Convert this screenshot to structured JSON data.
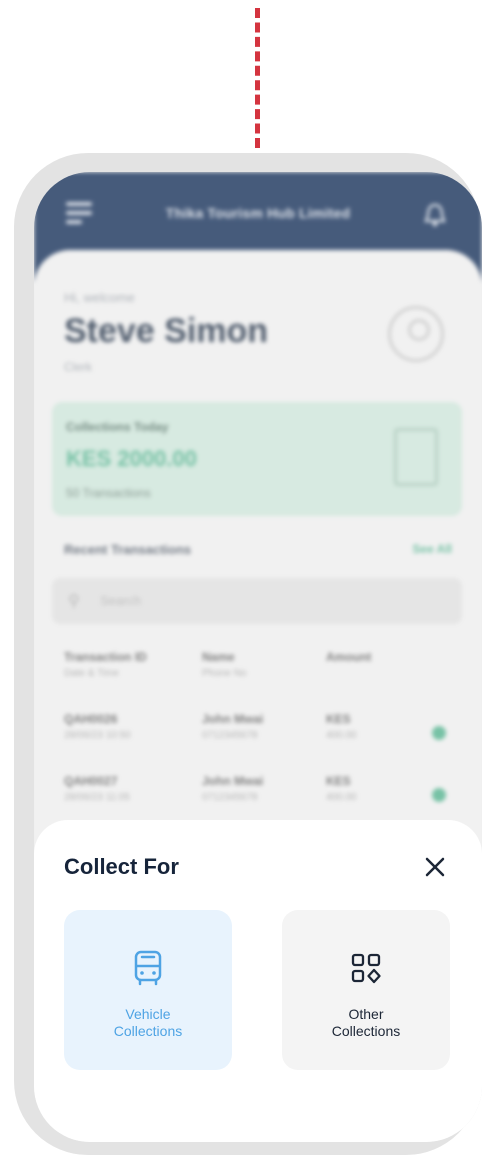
{
  "app": {
    "title": "Thika Tourism Hub Limited"
  },
  "dashboard": {
    "welcome": "Hi, welcome",
    "user_name": "Steve Simon",
    "user_role": "Clerk",
    "collections_label": "Collections Today",
    "collections_amount": "KES 2000.00",
    "collections_count": "50 Transactions",
    "recent_title": "Recent Transactions",
    "see_all": "See All",
    "search_placeholder": "Search",
    "table_headers": [
      {
        "title": "Transaction ID",
        "sub": "Date & Time"
      },
      {
        "title": "Name",
        "sub": "Phone No"
      },
      {
        "title": "Amount",
        "sub": ""
      }
    ],
    "rows": [
      {
        "id": "QAH0026",
        "date": "28/06/23 10:50",
        "name": "John Mwai",
        "phone": "0712345678",
        "amount": "400.00",
        "status": "KES"
      },
      {
        "id": "QAH0027",
        "date": "28/06/23 11:05",
        "name": "John Mwai",
        "phone": "0712345678",
        "amount": "400.00",
        "status": "KES"
      }
    ]
  },
  "sheet": {
    "title": "Collect For",
    "options": [
      {
        "label_line1": "Vehicle",
        "label_line2": "Collections",
        "icon": "bus-icon"
      },
      {
        "label_line1": "Other",
        "label_line2": "Collections",
        "icon": "grid-icon"
      }
    ]
  },
  "colors": {
    "header": "#0e2a55",
    "accent_green": "#4fb38d",
    "accent_blue": "#4ea3e4",
    "sheet_title": "#16243a",
    "annotation_line": "#d4343f"
  }
}
